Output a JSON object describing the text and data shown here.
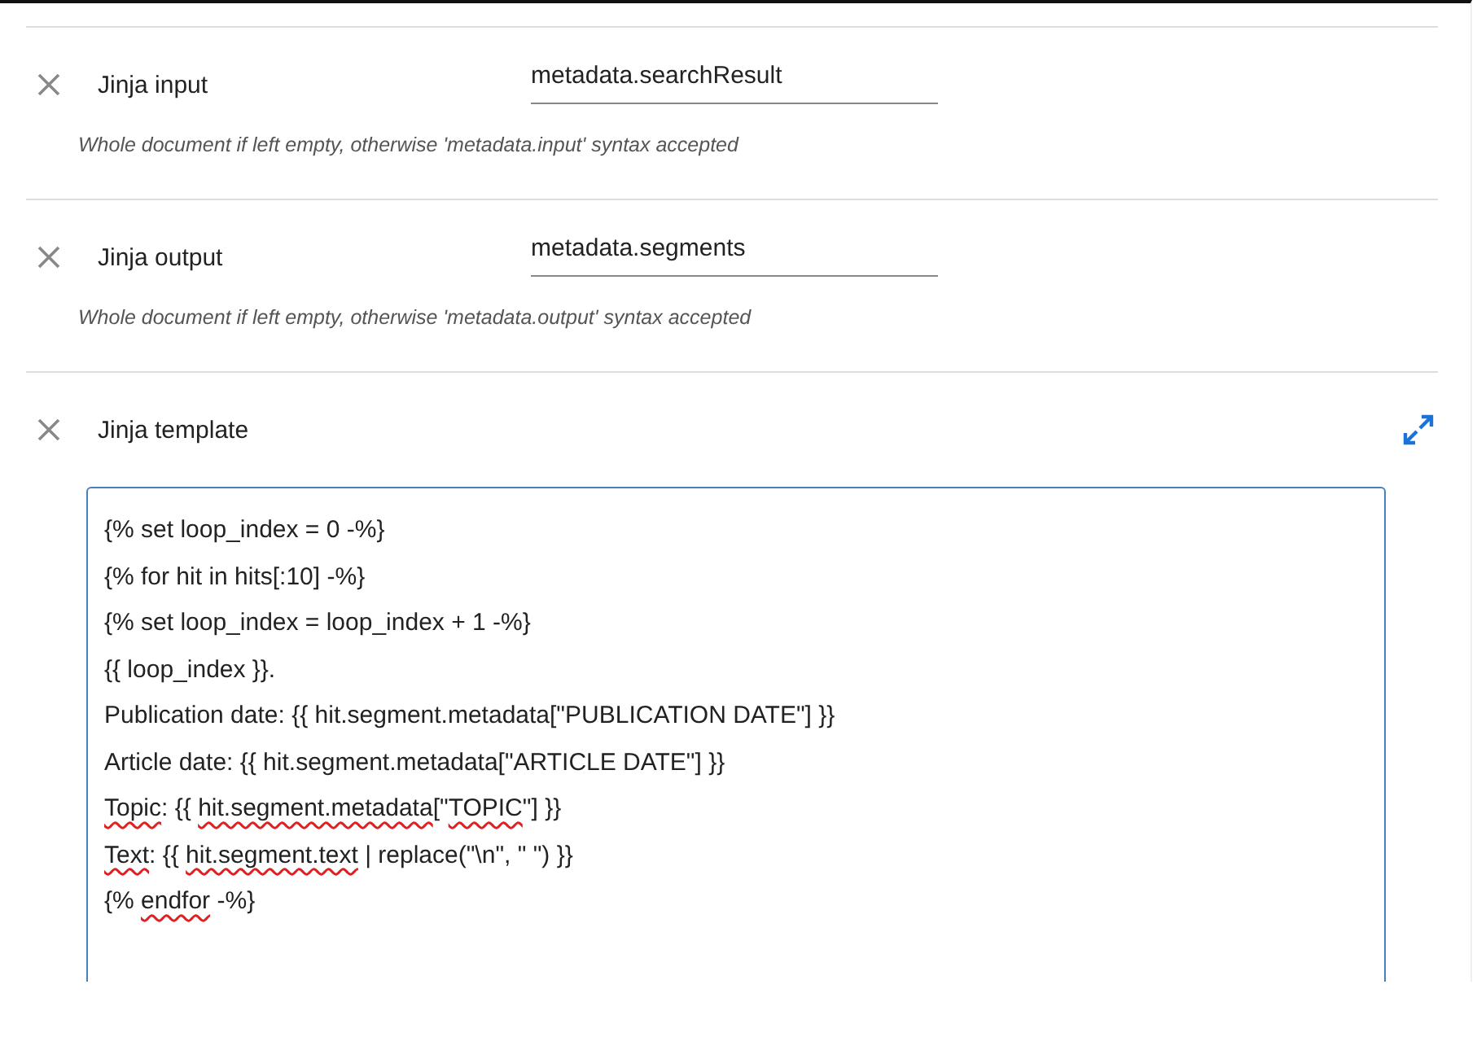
{
  "fields": [
    {
      "label": "Jinja input",
      "value": "metadata.searchResult",
      "hint": "Whole document if left empty, otherwise 'metadata.input' syntax accepted"
    },
    {
      "label": "Jinja output",
      "value": "metadata.segments",
      "hint": "Whole document if left empty, otherwise 'metadata.output' syntax accepted"
    }
  ],
  "template": {
    "label": "Jinja template",
    "lines": [
      [
        {
          "text": "{% set loop_index = 0 -%}",
          "misspelled": false
        }
      ],
      [
        {
          "text": "{% for hit in hits[:10] -%}",
          "misspelled": false
        }
      ],
      [
        {
          "text": "{% set loop_index = loop_index + 1 -%}",
          "misspelled": false
        }
      ],
      [
        {
          "text": "{{ loop_index }}.",
          "misspelled": false
        }
      ],
      [
        {
          "text": "Publication date: {{ hit.segment.metadata[\"PUBLICATION DATE\"] }}",
          "misspelled": false
        }
      ],
      [
        {
          "text": "Article date: {{ hit.segment.metadata[\"ARTICLE DATE\"] }}",
          "misspelled": false
        }
      ],
      [
        {
          "text": "Topic",
          "misspelled": true
        },
        {
          "text": ": {{ ",
          "misspelled": false
        },
        {
          "text": "hit.segment.metadata",
          "misspelled": true
        },
        {
          "text": "[\"",
          "misspelled": false
        },
        {
          "text": "TOPIC",
          "misspelled": true
        },
        {
          "text": "\"] }}",
          "misspelled": false
        }
      ],
      [
        {
          "text": "Text",
          "misspelled": true
        },
        {
          "text": ": {{ ",
          "misspelled": false
        },
        {
          "text": "hit.segment.text",
          "misspelled": true
        },
        {
          "text": " | replace(\"\\n\", \" \") }}",
          "misspelled": false
        }
      ],
      [
        {
          "text": "{% ",
          "misspelled": false
        },
        {
          "text": "endfor",
          "misspelled": true
        },
        {
          "text": " -%}",
          "misspelled": false
        }
      ]
    ]
  }
}
